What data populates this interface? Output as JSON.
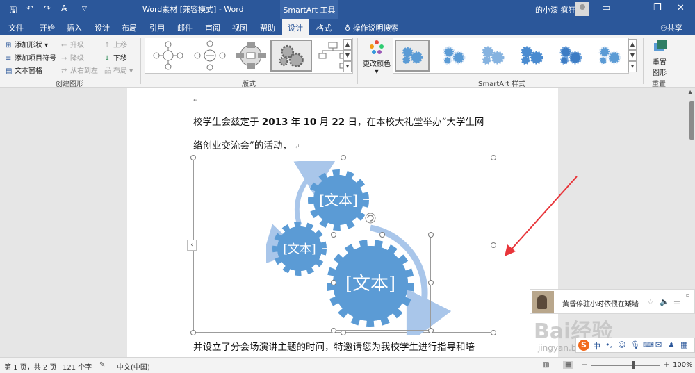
{
  "titlebar": {
    "title": "Word素材 [兼容模式] - Word",
    "context_tab": "SmartArt 工具",
    "user": "的小漆 疯狂",
    "undo_icon": "↶",
    "redo_icon": "↷",
    "save_icon": "💾",
    "min_icon": "—",
    "max_icon": "❐",
    "close_icon": "✕",
    "ribbon_opt_icon": "▭"
  },
  "tabs": {
    "items": [
      "文件",
      "开始",
      "插入",
      "设计",
      "布局",
      "引用",
      "邮件",
      "审阅",
      "视图",
      "帮助",
      "设计",
      "格式"
    ],
    "tell_me": "操作说明搜索",
    "share": "共享"
  },
  "ribbon": {
    "create_graphic": {
      "add_shape": "添加形状",
      "add_bullet": "添加项目符号",
      "text_pane": "文本窗格",
      "promote": "升级",
      "demote": "降级",
      "rtl": "从右到左",
      "move_up": "上移",
      "move_down": "下移",
      "layout": "布局",
      "label": "创建图形"
    },
    "layouts": {
      "label": "版式"
    },
    "styles": {
      "change_colors": "更改颜色",
      "label": "SmartArt 样式"
    },
    "reset": {
      "reset_graphic_1": "重置",
      "reset_graphic_2": "图形",
      "label": "重置"
    }
  },
  "document": {
    "line1_a": "校学生会兹定于 ",
    "line1_year": "2013",
    "line1_b": " 年 ",
    "line1_month": "10",
    "line1_c": " 月 ",
    "line1_day": "22",
    "line1_d": " 日，在本校大礼堂举办“大学生网",
    "line2": "络创业交流会”的活动，",
    "line3": "并设立了分会场演讲主题的时间，特邀请您为我校学生进行指导和培",
    "gear_text_1": "[文本]",
    "gear_text_2": "[文本]",
    "gear_text_3": "[文本]",
    "para_mark": "↵",
    "collapse_icon": "‹"
  },
  "music": {
    "song": "黄昏停驻小时依偎在矮墙"
  },
  "watermark": {
    "brand": "Bai经验",
    "url": "jingyan.baidu.com"
  },
  "ime": {
    "logo": "S",
    "mode": "中"
  },
  "status": {
    "page": "第 1 页，共 2 页",
    "words": "121 个字",
    "lang": "中文(中国)",
    "zoom": "100%",
    "zoom_minus": "−",
    "zoom_plus": "+"
  },
  "colors": {
    "brand": "#2b579a",
    "gear": "#5b9bd5",
    "arrow": "#a9c6ea",
    "red_arrow": "#e8353a"
  }
}
